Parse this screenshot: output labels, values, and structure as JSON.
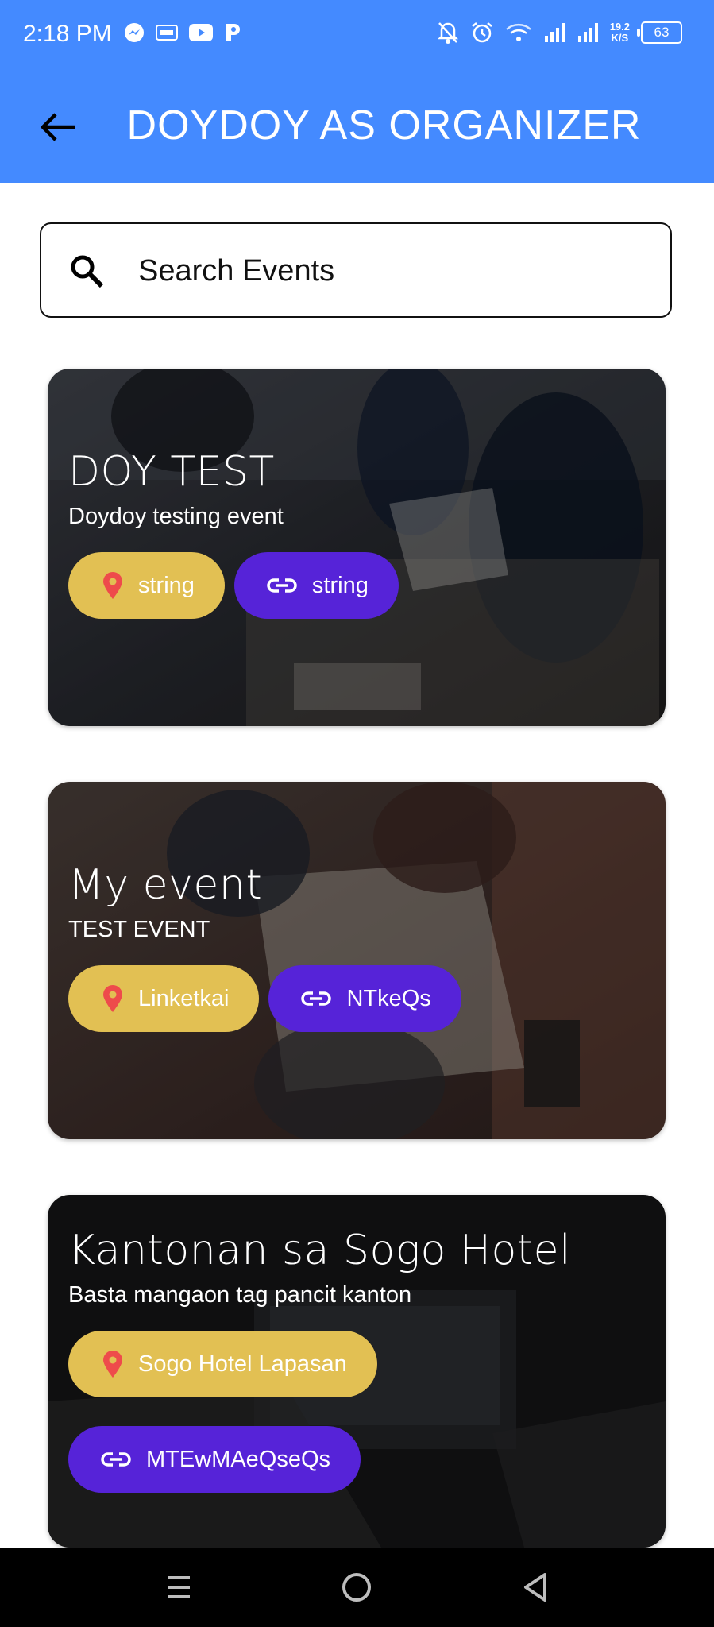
{
  "status_bar": {
    "time": "2:18 PM",
    "left_icons": [
      "messenger-icon",
      "temu-icon",
      "youtube-icon",
      "pay-icon"
    ],
    "right_icons": [
      "notifications-off-icon",
      "alarm-icon",
      "wifi-icon",
      "signal-icon",
      "signal-icon"
    ],
    "network_speed_value": "19.2",
    "network_speed_unit": "K/S",
    "battery": "63"
  },
  "app_bar": {
    "title": "DOYDOY AS ORGANIZER",
    "back_icon": "arrow-back-icon"
  },
  "search": {
    "placeholder": "Search Events",
    "icon": "search-icon"
  },
  "events": [
    {
      "title": "DOY TEST",
      "description": "Doydoy testing event",
      "location": "string",
      "link": "string"
    },
    {
      "title": "My event",
      "description": "TEST EVENT",
      "location": "Linketkai",
      "link": "NTkeQs"
    },
    {
      "title": "Kantonan sa Sogo Hotel",
      "description": "Basta mangaon tag pancit kanton",
      "location": "Sogo Hotel Lapasan",
      "link": "MTEwMAeQseQs"
    }
  ],
  "colors": {
    "app_bar": "#448aff",
    "location_chip": "#e2c053",
    "link_chip": "#5623d8"
  },
  "nav_bar": {
    "buttons": [
      "menu-icon",
      "home-circle-icon",
      "back-triangle-icon"
    ]
  }
}
